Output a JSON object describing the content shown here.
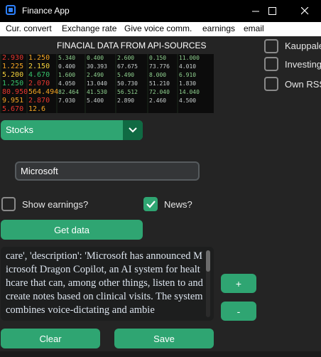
{
  "window": {
    "title": "Finance App",
    "controls": {
      "minimize": "—",
      "maximize": "☐",
      "close": "✕"
    }
  },
  "menu": [
    "Cur. convert",
    "Exchange rate",
    "Give voice comm.",
    "earnings",
    "email"
  ],
  "header": {
    "title": "FINACIAL DATA FROM API-SOURCES"
  },
  "banner": {
    "icon": "stock-ticker-image",
    "ticker_values": [
      "2.930",
      "1.250",
      "5.340",
      "0.400",
      "2.600",
      "0.150",
      "11.000",
      "1.225",
      "2.150",
      "0.400",
      "30.393",
      "67.675",
      "73.776",
      "4.010",
      "5.200",
      "4.670",
      "1.600",
      "2.490",
      "5.490",
      "8.000",
      "6.910",
      "1.250",
      "2.070",
      "4.050",
      "13.040",
      "50.730",
      "51.210",
      "1.830",
      "80.950",
      "564.494",
      "82.464",
      "41.530",
      "56.512",
      "72.040",
      "14.040",
      "9.951",
      "2.870",
      "7.030",
      "5.400",
      "2.890",
      "2.460",
      "4.500",
      "5.670",
      "12.6"
    ]
  },
  "sources": [
    {
      "label": "Kauppalehti",
      "checked": false
    },
    {
      "label": "Investing",
      "checked": false
    },
    {
      "label": "Own RSS",
      "checked": false
    }
  ],
  "dropdown": {
    "value": "Stocks"
  },
  "search": {
    "value": "Microsoft"
  },
  "options": {
    "show_earnings": {
      "label": "Show earnings?",
      "checked": false
    },
    "news": {
      "label": "News?",
      "checked": true
    }
  },
  "buttons": {
    "get_data": "Get data",
    "plus": "+",
    "minus": "-",
    "clear": "Clear",
    "save": "Save"
  },
  "output": {
    "text": "care', 'description': 'Microsoft has announced Microsoft Dragon Copilot, an AI system for healthcare that can, among other things, listen to and create notes based on clinical visits. The system combines voice-dictating and ambie"
  },
  "colors": {
    "accent": "#2fa572",
    "accent_dark": "#106a43",
    "background": "#242424",
    "titlebar": "#000000",
    "menubar": "#ffffff"
  }
}
